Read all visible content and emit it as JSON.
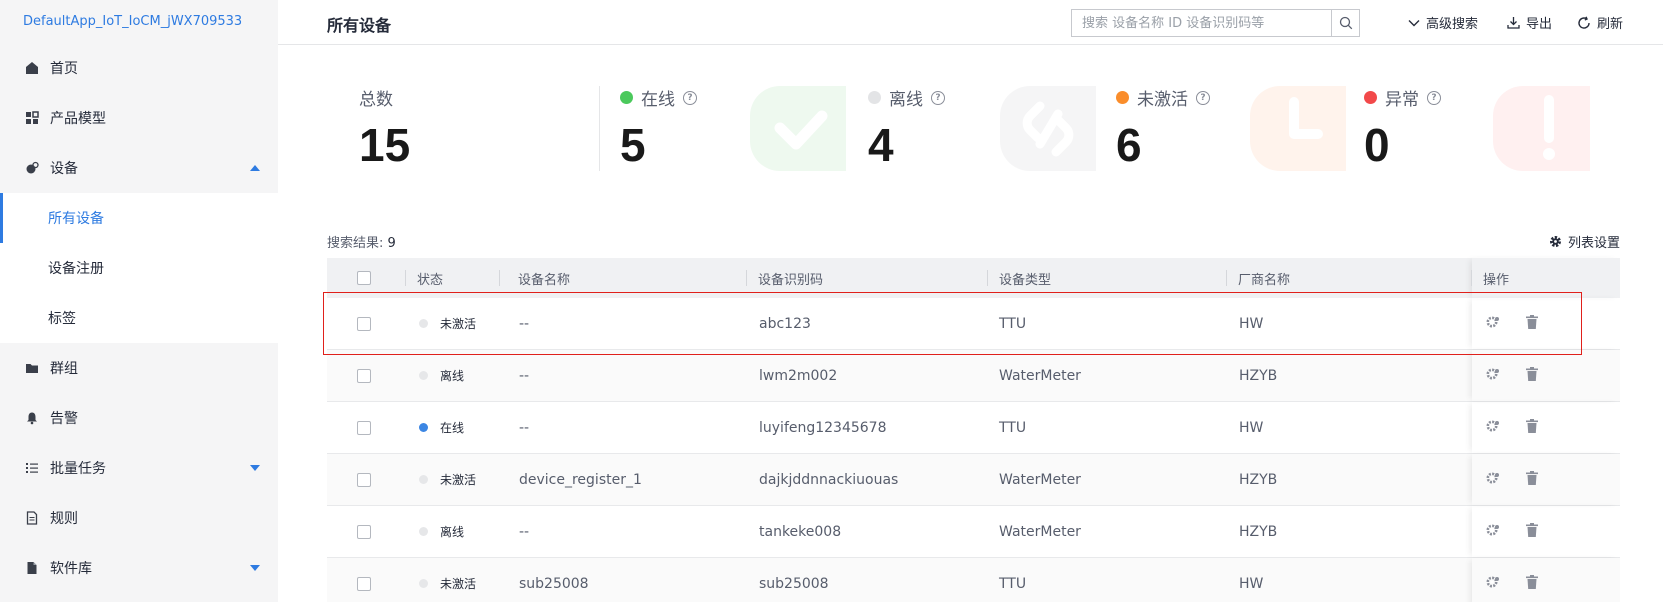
{
  "sidebar": {
    "app_name": "DefaultApp_IoT_IoCM_jWX709533",
    "items": [
      {
        "label": "首页",
        "icon": "home-icon"
      },
      {
        "label": "产品模型",
        "icon": "product-model-icon"
      },
      {
        "label": "设备",
        "icon": "device-icon",
        "expanded": true
      },
      {
        "label": "群组",
        "icon": "folder-icon"
      },
      {
        "label": "告警",
        "icon": "bell-icon"
      },
      {
        "label": "批量任务",
        "icon": "list-icon"
      },
      {
        "label": "规则",
        "icon": "document-icon"
      },
      {
        "label": "软件库",
        "icon": "file-icon"
      }
    ],
    "sub_items": [
      {
        "label": "所有设备",
        "active": true
      },
      {
        "label": "设备注册"
      },
      {
        "label": "标签"
      }
    ]
  },
  "header": {
    "title": "所有设备",
    "search_placeholder": "搜索 设备名称 ID 设备识别码等",
    "advanced_search": "高级搜索",
    "export": "导出",
    "refresh": "刷新"
  },
  "stats": {
    "total": {
      "label": "总数",
      "value": "15"
    },
    "online": {
      "label": "在线",
      "value": "5",
      "color": "#4bc95c"
    },
    "offline": {
      "label": "离线",
      "value": "4",
      "color": "#e3e4e6"
    },
    "inactive": {
      "label": "未激活",
      "value": "6",
      "color": "#fa8d2b"
    },
    "abnormal": {
      "label": "异常",
      "value": "0",
      "color": "#f2494a"
    }
  },
  "results": {
    "label": "搜索结果: ",
    "count": "9"
  },
  "list_settings": "列表设置",
  "table": {
    "columns": {
      "status": "状态",
      "name": "设备名称",
      "code": "设备识别码",
      "type": "设备类型",
      "vendor": "厂商名称",
      "ops": "操作"
    },
    "rows": [
      {
        "status": "未激活",
        "status_color": "#e6e7e9",
        "name": "--",
        "code": "abc123",
        "type": "TTU",
        "vendor": "HW"
      },
      {
        "status": "离线",
        "status_color": "#e6e7e9",
        "name": "--",
        "code": "lwm2m002",
        "type": "WaterMeter",
        "vendor": "HZYB"
      },
      {
        "status": "在线",
        "status_color": "#3c86e3",
        "name": "--",
        "code": "luyifeng12345678",
        "type": "TTU",
        "vendor": "HW"
      },
      {
        "status": "未激活",
        "status_color": "#e6e7e9",
        "name": "device_register_1",
        "code": "dajkjddnnackiuouas",
        "type": "WaterMeter",
        "vendor": "HZYB"
      },
      {
        "status": "离线",
        "status_color": "#e6e7e9",
        "name": "--",
        "code": "tankeke008",
        "type": "WaterMeter",
        "vendor": "HZYB"
      },
      {
        "status": "未激活",
        "status_color": "#e6e7e9",
        "name": "sub25008",
        "code": "sub25008",
        "type": "TTU",
        "vendor": "HW"
      }
    ]
  }
}
